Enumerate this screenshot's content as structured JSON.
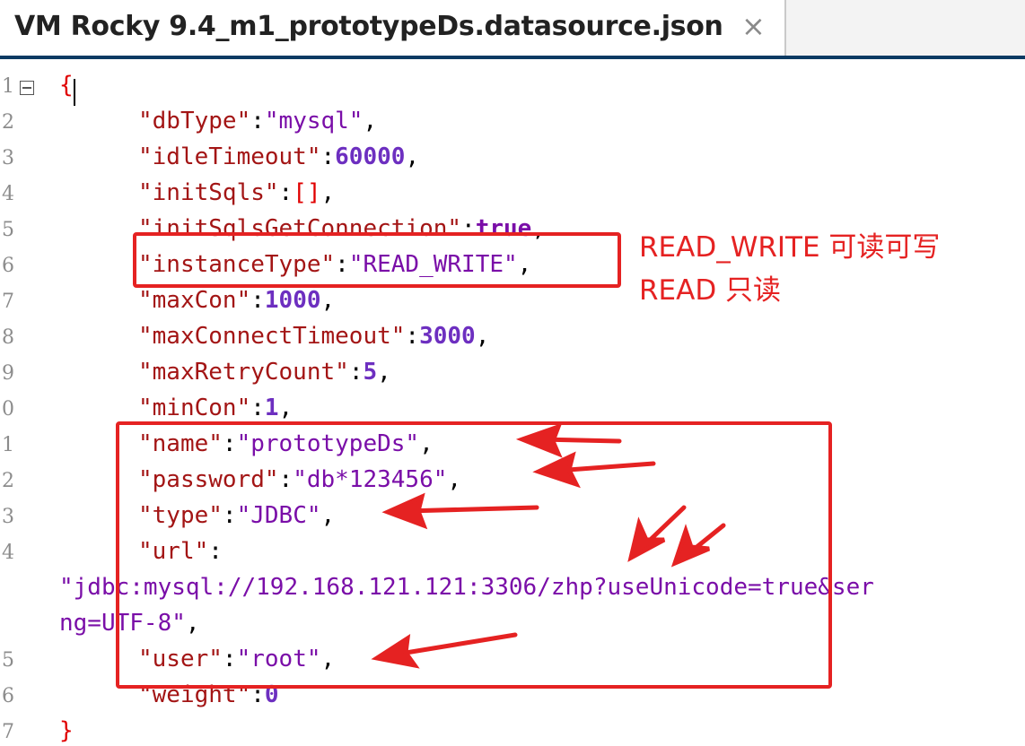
{
  "tab": {
    "title": "VM Rocky 9.4_m1_prototypeDs.datasource.json",
    "close": "×"
  },
  "editor": {
    "lines": [
      {
        "no": "1",
        "open": "{"
      },
      {
        "no": "2",
        "key": "\"dbType\"",
        "value": "\"mysql\"",
        "vtype": "string"
      },
      {
        "no": "3",
        "key": "\"idleTimeout\"",
        "value": "60000",
        "vtype": "number"
      },
      {
        "no": "4",
        "key": "\"initSqls\"",
        "value": "[]",
        "vtype": "array"
      },
      {
        "no": "5",
        "key": "\"initSqlsGetConnection\"",
        "value": "true",
        "vtype": "bool"
      },
      {
        "no": "6",
        "key": "\"instanceType\"",
        "value": "\"READ_WRITE\"",
        "vtype": "string"
      },
      {
        "no": "7",
        "key": "\"maxCon\"",
        "value": "1000",
        "vtype": "number"
      },
      {
        "no": "8",
        "key": "\"maxConnectTimeout\"",
        "value": "3000",
        "vtype": "number"
      },
      {
        "no": "9",
        "key": "\"maxRetryCount\"",
        "value": "5",
        "vtype": "number"
      },
      {
        "no": "0",
        "key": "\"minCon\"",
        "value": "1",
        "vtype": "number"
      },
      {
        "no": "1",
        "key": "\"name\"",
        "value": "\"prototypeDs\"",
        "vtype": "string"
      },
      {
        "no": "2",
        "key": "\"password\"",
        "value": "\"db*123456\"",
        "vtype": "string"
      },
      {
        "no": "3",
        "key": "\"type\"",
        "value": "\"JDBC\"",
        "vtype": "string"
      },
      {
        "no": "4",
        "key": "\"url\"",
        "value": "",
        "vtype": "none"
      },
      {
        "no": "",
        "wrap": "\"jdbc:mysql://192.168.121.121:3306/zhp?useUnicode=true&ser"
      },
      {
        "no": "",
        "wrap": "ng=UTF-8\"",
        "wraptail": ","
      },
      {
        "no": "5",
        "key": "\"user\"",
        "value": "\"root\"",
        "vtype": "string"
      },
      {
        "no": "6",
        "key": "\"weight\"",
        "value": "0",
        "vtype": "number",
        "last": true
      },
      {
        "no": "7",
        "close": "}"
      }
    ]
  },
  "annotation": {
    "note_line1": "READ_WRITE 可读可写",
    "note_line2": "READ 只读",
    "color": "#e52222"
  }
}
